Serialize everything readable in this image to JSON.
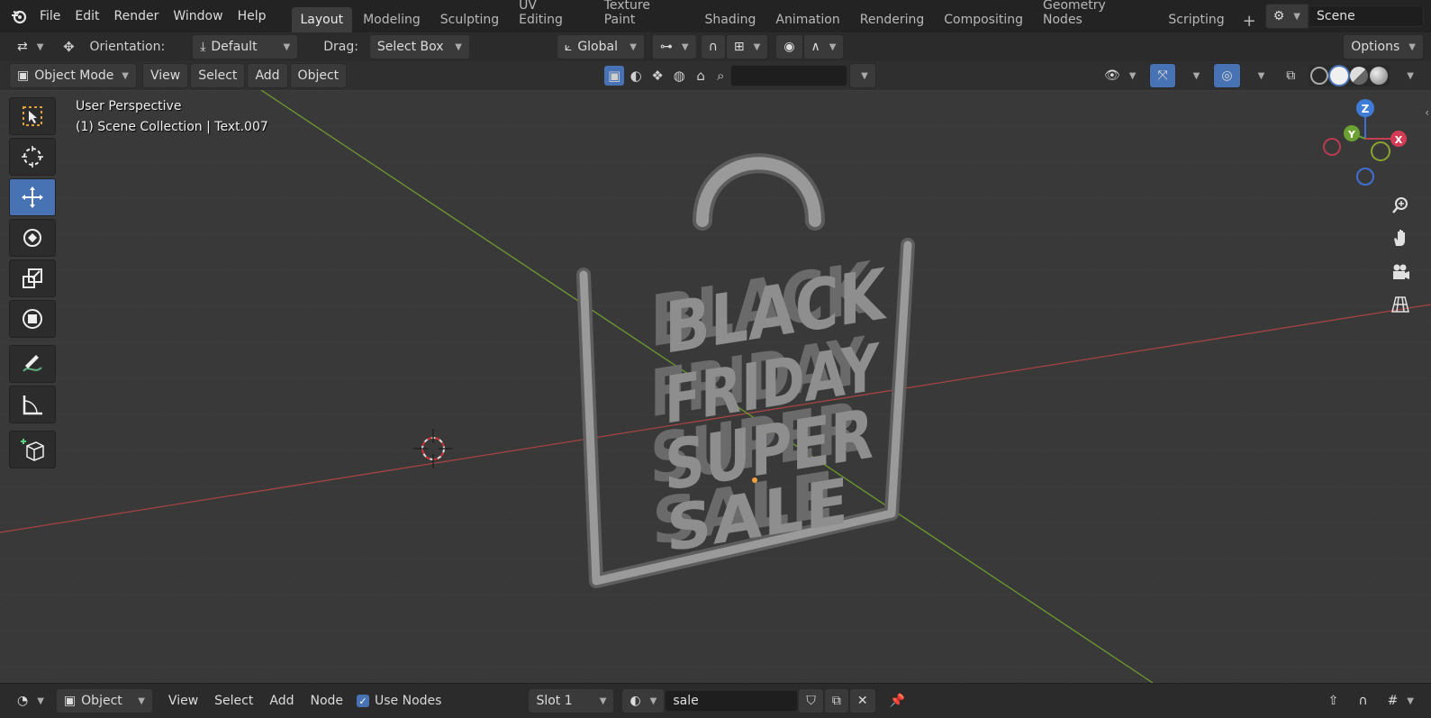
{
  "menu": {
    "file": "File",
    "edit": "Edit",
    "render": "Render",
    "window": "Window",
    "help": "Help"
  },
  "workspaces": [
    "Layout",
    "Modeling",
    "Sculpting",
    "UV Editing",
    "Texture Paint",
    "Shading",
    "Animation",
    "Rendering",
    "Compositing",
    "Geometry Nodes",
    "Scripting"
  ],
  "add_workspace": "+",
  "scene": "Scene",
  "tool_header": {
    "orientation_label": "Orientation:",
    "orientation_value": "Default",
    "drag_label": "Drag:",
    "drag_value": "Select Box",
    "transform_orientation": "Global",
    "options": "Options"
  },
  "view_header": {
    "mode": "Object Mode",
    "view": "View",
    "select": "Select",
    "add": "Add",
    "object": "Object"
  },
  "viewport": {
    "perspective": "User Perspective",
    "collection": "(1) Scene Collection | Text.007",
    "text_lines": [
      "BLACK",
      "FRIDAY",
      "SUPER",
      "SALE"
    ],
    "gizmo": {
      "z": "Z",
      "y": "Y",
      "x": "X"
    },
    "colors": {
      "bg": "#393939",
      "grid": "#454545",
      "x_axis": "#a54343",
      "y_axis": "#6e9a2e",
      "mesh": "#8e8e8e",
      "active": "#4772b3"
    }
  },
  "node_header": {
    "editor": "Object",
    "view": "View",
    "select": "Select",
    "add": "Add",
    "node": "Node",
    "use_nodes": "Use Nodes",
    "slot": "Slot 1",
    "material": "sale"
  }
}
